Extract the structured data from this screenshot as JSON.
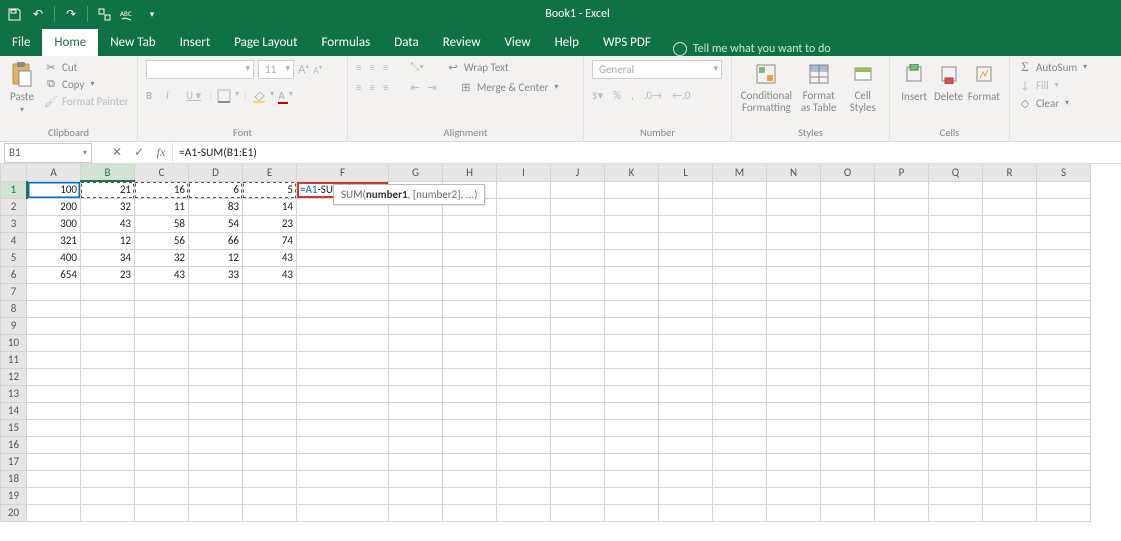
{
  "window_title": "Book1 - Excel",
  "qat": [
    "save",
    "undo",
    "redo",
    "touch-mode",
    "repeat",
    "spellcheck"
  ],
  "tabs": {
    "items": [
      "File",
      "Home",
      "New Tab",
      "Insert",
      "Page Layout",
      "Formulas",
      "Data",
      "Review",
      "View",
      "Help",
      "WPS PDF"
    ],
    "active_index": 1,
    "tell_me": "Tell me what you want to do"
  },
  "ribbon": {
    "clipboard": {
      "title": "Clipboard",
      "paste": "Paste",
      "cut": "Cut",
      "copy": "Copy",
      "painter": "Format Painter"
    },
    "font": {
      "title": "Font",
      "family": "",
      "size": "11",
      "inc": "A",
      "dec": "A",
      "b": "B",
      "i": "I",
      "u": "U"
    },
    "alignment": {
      "title": "Alignment",
      "wrap": "Wrap Text",
      "merge": "Merge & Center"
    },
    "number": {
      "title": "Number",
      "format": "General"
    },
    "styles": {
      "title": "Styles",
      "cond": "Conditional Formatting",
      "table": "Format as Table",
      "cell": "Cell Styles"
    },
    "cells": {
      "title": "Cells",
      "insert": "Insert",
      "delete": "Delete",
      "format": "Format"
    },
    "editing": {
      "autosum": "AutoSum",
      "fill": "Fill",
      "clear": "Clear"
    }
  },
  "namebox": "B1",
  "formula_display": "=A1-SUM(B1:E1)",
  "formula_tokens": {
    "prefix": "=",
    "ref1": "A1",
    "mid": "-SUM(",
    "ref2": "B1:E1",
    "suffix": ")"
  },
  "cell_editing": "=A1-SUM(B1:E1)",
  "tooltip": {
    "fn": "SUM",
    "sig1": "number1",
    "sig2": ", [number2], ...)"
  },
  "columns": [
    "A",
    "B",
    "C",
    "D",
    "E",
    "F",
    "G",
    "H",
    "I",
    "J",
    "K",
    "L",
    "M",
    "N",
    "O",
    "P",
    "Q",
    "R",
    "S"
  ],
  "row_count": 20,
  "data": {
    "A": [
      100,
      200,
      300,
      321,
      400,
      654
    ],
    "B": [
      21,
      32,
      43,
      12,
      34,
      23
    ],
    "C": [
      16,
      11,
      58,
      56,
      32,
      43
    ],
    "D": [
      6,
      83,
      54,
      66,
      12,
      33
    ],
    "E": [
      5,
      14,
      23,
      74,
      43,
      43
    ]
  },
  "colors": {
    "excel_green": "#0f7244",
    "accent": "#217346",
    "marquee": "#555",
    "edit_border": "#cf3a2c"
  }
}
